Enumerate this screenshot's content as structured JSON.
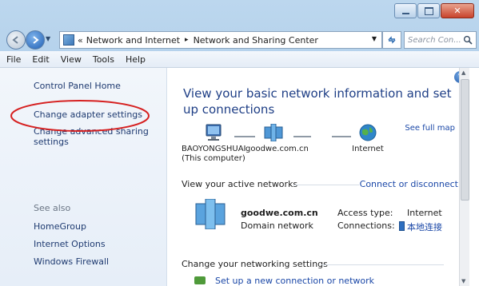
{
  "window": {
    "close_label": "✕"
  },
  "address": {
    "prefix": "«",
    "segment1": "Network and Internet",
    "separator": "▸",
    "segment2": "Network and Sharing Center",
    "search_placeholder": "Search Con..."
  },
  "menu": [
    "File",
    "Edit",
    "View",
    "Tools",
    "Help"
  ],
  "sidebar": {
    "home": "Control Panel Home",
    "change_adapter": "Change adapter settings",
    "change_sharing_1": "Change advanced sharing",
    "change_sharing_2": "settings",
    "see_also": "See also",
    "homegroup": "HomeGroup",
    "internet_options": "Internet Options",
    "firewall": "Windows Firewall"
  },
  "main": {
    "title": "View your basic network information and set up connections",
    "see_full_map": "See full map",
    "computer_name": "BAOYONGSHUAI",
    "computer_sub": "(This computer)",
    "domain": "goodwe.com.cn",
    "internet": "Internet",
    "active_networks": "View your active networks",
    "connect_disconnect": "Connect or disconnect",
    "network_name": "goodwe.com.cn",
    "network_type": "Domain network",
    "access_type_label": "Access type:",
    "access_type_value": "Internet",
    "connections_label": "Connections:",
    "connections_value": "本地连接",
    "change_settings": "Change your networking settings",
    "new_connection": "Set up a new connection or network"
  },
  "colors": {
    "accent": "#1f3f86",
    "link": "#1a47a7",
    "highlight_ellipse": "#d62020"
  }
}
